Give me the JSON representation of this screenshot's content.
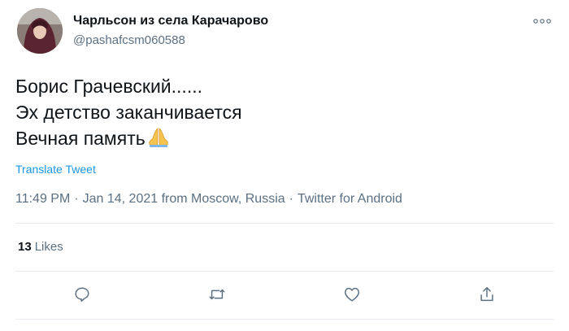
{
  "author": {
    "name": "Чарльсон из села Карачарово",
    "handle": "@pashafcsm060588"
  },
  "tweet": {
    "lines": [
      "Борис Грачевский......",
      "Эх детство заканчивается",
      "Вечная память"
    ],
    "emoji": "folded-hands-icon"
  },
  "translate_label": "Translate Tweet",
  "meta": {
    "time": "11:49 PM",
    "date": "Jan 14, 2021",
    "location": "from Moscow, Russia",
    "separator": "·",
    "source": "Twitter for Android"
  },
  "stats": {
    "likes_count": "13",
    "likes_label": "Likes"
  },
  "colors": {
    "link": "#1b95e0",
    "secondary_text": "#5b7083",
    "divider": "#e6ecf0",
    "icon": "#5b7083"
  },
  "actions": [
    "reply-icon",
    "retweet-icon",
    "like-icon",
    "share-icon"
  ]
}
